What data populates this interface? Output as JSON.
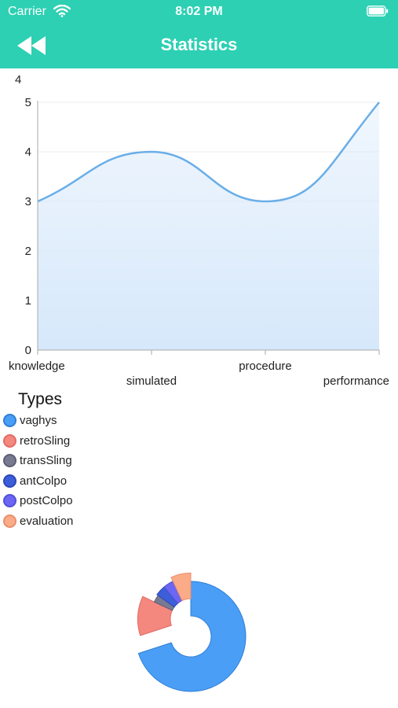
{
  "status_bar": {
    "carrier": "Carrier",
    "time": "8:02 PM"
  },
  "nav": {
    "title": "Statistics",
    "back_icon": "double-chevron-left-icon"
  },
  "colors": {
    "accent": "#2dd0b3"
  },
  "chart_data": [
    {
      "type": "area",
      "corner_label": "4",
      "categories": [
        "knowledge",
        "simulated",
        "procedure",
        "performance"
      ],
      "values": [
        3,
        4,
        3,
        5
      ],
      "ylim": [
        0,
        5
      ],
      "yticks": [
        "0",
        "1",
        "2",
        "3",
        "4",
        "5"
      ],
      "line_color": "#6aaee8",
      "fill_color": "#d6e8fb",
      "grid": true
    },
    {
      "type": "pie",
      "legend_title": "Types",
      "donut": true,
      "labels": [
        "vaghys",
        "retroSling",
        "transSling",
        "antColpo",
        "postColpo",
        "evaluation"
      ],
      "values": [
        70,
        12,
        3,
        4,
        4,
        7
      ],
      "colors": [
        "#4a9ef5",
        "#f4877e",
        "#787a92",
        "#3c5ed8",
        "#6c66f2",
        "#fbab88"
      ],
      "border_colors": [
        "#2f7fd6",
        "#e26c66",
        "#5d5f76",
        "#2e47b8",
        "#5450d8",
        "#e88f6c"
      ]
    }
  ]
}
